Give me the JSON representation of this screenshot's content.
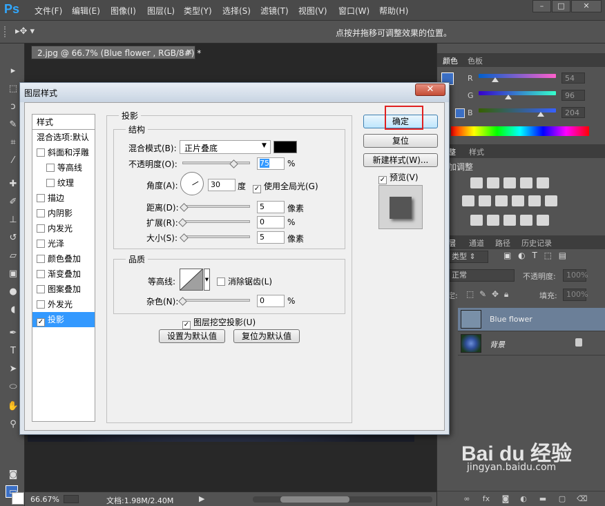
{
  "menu": {
    "logo": "Ps",
    "items": [
      "文件(F)",
      "编辑(E)",
      "图像(I)",
      "图层(L)",
      "类型(Y)",
      "选择(S)",
      "滤镜(T)",
      "视图(V)",
      "窗口(W)",
      "帮助(H)"
    ]
  },
  "options": {
    "hint": "点按并拖移可调整效果的位置。"
  },
  "document": {
    "tab_title": "2.jpg @ 66.7% (Blue flower , RGB/8#) *",
    "close_glyph": "×",
    "zoom": "66.67%",
    "doc_size": "文档:1.98M/2.40M"
  },
  "panels": {
    "color_tabs": [
      "颜色",
      "色板"
    ],
    "channels": [
      {
        "label": "R",
        "value": "54",
        "fraction": 0.21
      },
      {
        "label": "G",
        "value": "96",
        "fraction": 0.38
      },
      {
        "label": "B",
        "value": "204",
        "fraction": 0.8
      }
    ],
    "adjust_tabs": [
      "整",
      "样式"
    ],
    "adjust_title": "加调整",
    "layers_tabs": [
      "层",
      "通道",
      "路径",
      "历史记录"
    ],
    "kind_filter": "类型",
    "blend_mode": "正常",
    "opacity_label": "不透明度:",
    "opacity_value": "100%",
    "lock_label": "锁定:",
    "fill_label": "填充:",
    "fill_value": "100%",
    "layers": [
      {
        "name": "Blue flower",
        "selected": true
      },
      {
        "name": "背景",
        "selected": false,
        "locked": true
      }
    ]
  },
  "watermark": {
    "logo": "Bai du 经验",
    "url": "jingyan.baidu.com"
  },
  "dialog": {
    "title": "图层样式",
    "close_glyph": "✕",
    "styles_header": "样式",
    "style_items": [
      {
        "label": "混合选项:默认",
        "checkbox": false,
        "sub": false
      },
      {
        "label": "斜面和浮雕",
        "checkbox": true,
        "checked": false,
        "sub": false
      },
      {
        "label": "等高线",
        "checkbox": true,
        "checked": false,
        "sub": true
      },
      {
        "label": "纹理",
        "checkbox": true,
        "checked": false,
        "sub": true
      },
      {
        "label": "描边",
        "checkbox": true,
        "checked": false,
        "sub": false
      },
      {
        "label": "内阴影",
        "checkbox": true,
        "checked": false,
        "sub": false
      },
      {
        "label": "内发光",
        "checkbox": true,
        "checked": false,
        "sub": false
      },
      {
        "label": "光泽",
        "checkbox": true,
        "checked": false,
        "sub": false
      },
      {
        "label": "颜色叠加",
        "checkbox": true,
        "checked": false,
        "sub": false
      },
      {
        "label": "渐变叠加",
        "checkbox": true,
        "checked": false,
        "sub": false
      },
      {
        "label": "图案叠加",
        "checkbox": true,
        "checked": false,
        "sub": false
      },
      {
        "label": "外发光",
        "checkbox": true,
        "checked": false,
        "sub": false
      },
      {
        "label": "投影",
        "checkbox": true,
        "checked": true,
        "sub": false,
        "active": true
      }
    ],
    "section_title": "投影",
    "structure": {
      "legend": "结构",
      "blend_mode_label": "混合模式(B):",
      "blend_mode_value": "正片叠底",
      "shadow_color": "#000000",
      "opacity_label": "不透明度(O):",
      "opacity_value": "75",
      "opacity_fraction": 0.75,
      "percent": "%",
      "angle_label": "角度(A):",
      "angle_value": "30",
      "angle_unit": "度",
      "global_light_label": "使用全局光(G)",
      "global_light_checked": true,
      "distance_label": "距离(D):",
      "distance_value": "5",
      "distance_fraction": 0.02,
      "spread_label": "扩展(R):",
      "spread_value": "0",
      "spread_fraction": 0.0,
      "size_label": "大小(S):",
      "size_value": "5",
      "size_fraction": 0.02,
      "px_unit": "像素"
    },
    "quality": {
      "legend": "品质",
      "contour_label": "等高线:",
      "antialias_label": "消除锯齿(L)",
      "antialias_checked": false,
      "noise_label": "杂色(N):",
      "noise_value": "0",
      "noise_fraction": 0.0,
      "percent": "%"
    },
    "knockout_label": "图层挖空投影(U)",
    "knockout_checked": true,
    "set_default_label": "设置为默认值",
    "reset_default_label": "复位为默认值",
    "ok_label": "确定",
    "reset_label": "复位",
    "new_style_label": "新建样式(W)...",
    "preview_label": "预览(V)",
    "preview_checked": true
  }
}
